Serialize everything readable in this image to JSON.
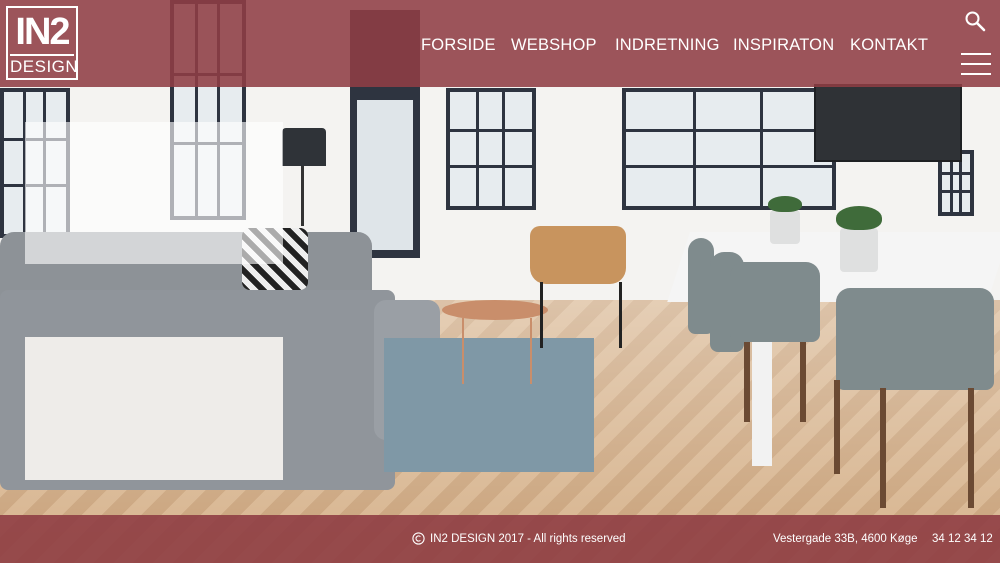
{
  "brand": {
    "logo_top": "IN2",
    "logo_bottom": "DESIGN"
  },
  "nav": {
    "items": [
      {
        "label": "FORSIDE"
      },
      {
        "label": "WEBSHOP"
      },
      {
        "label": "INDRETNING"
      },
      {
        "label": "INSPIRATON"
      },
      {
        "label": "KONTAKT"
      }
    ]
  },
  "header_icons": {
    "search": "search-icon",
    "menu": "hamburger-menu-icon"
  },
  "footer": {
    "copyright_icon": "copyright-icon",
    "copyright": "IN2 DESIGN 2017 - All rights reserved",
    "address": "Vestergade 33B, 4600 Køge",
    "phone": "34 12 34 12"
  },
  "colors": {
    "header_footer": "#8f3e44",
    "text": "#ffffff",
    "panel": "#f1efec"
  }
}
